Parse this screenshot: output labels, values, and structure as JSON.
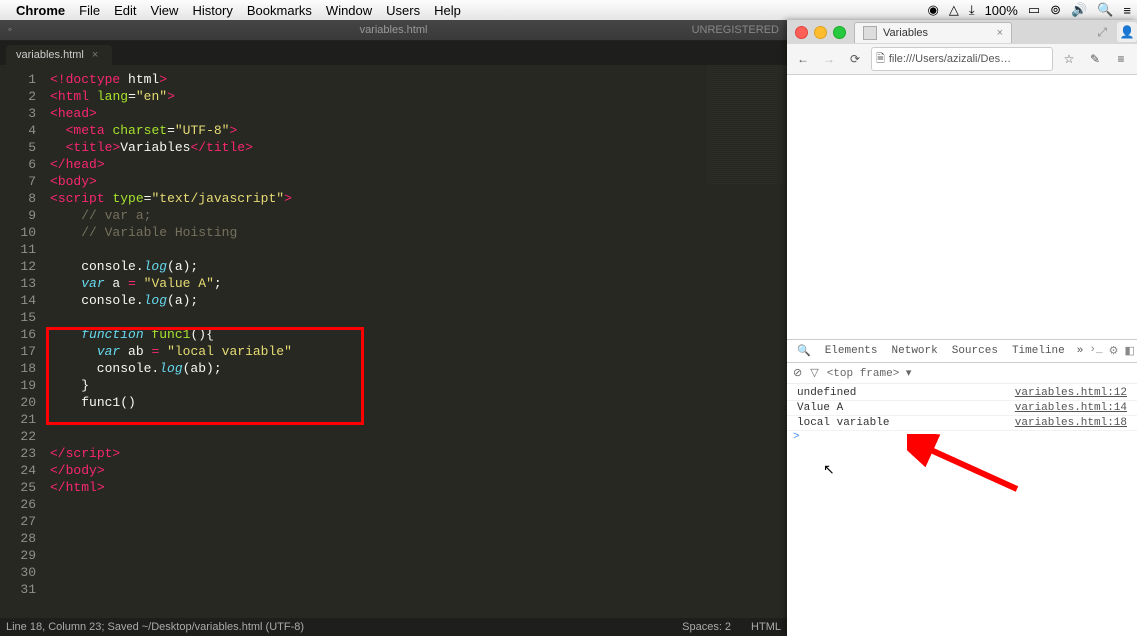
{
  "menubar": {
    "app": "Chrome",
    "items": [
      "File",
      "Edit",
      "View",
      "History",
      "Bookmarks",
      "Window",
      "Users",
      "Help"
    ],
    "battery": "100%"
  },
  "sublime": {
    "title": "variables.html",
    "unregistered": "UNREGISTERED",
    "tab": {
      "label": "variables.html"
    },
    "status_left": "Line 18, Column 23; Saved ~/Desktop/variables.html (UTF-8)",
    "status_spaces": "Spaces: 2",
    "status_lang": "HTML",
    "lines": [
      [
        {
          "t": "<!",
          "c": "c-tag"
        },
        {
          "t": "doctype",
          "c": "c-tag"
        },
        {
          "t": " html",
          "c": "c-name"
        },
        {
          "t": ">",
          "c": "c-tag"
        }
      ],
      [
        {
          "t": "<",
          "c": "c-tag"
        },
        {
          "t": "html",
          "c": "c-tag"
        },
        {
          "t": " ",
          "c": ""
        },
        {
          "t": "lang",
          "c": "c-attr"
        },
        {
          "t": "=",
          "c": "c-punct"
        },
        {
          "t": "\"en\"",
          "c": "c-str"
        },
        {
          "t": ">",
          "c": "c-tag"
        }
      ],
      [
        {
          "t": "<",
          "c": "c-tag"
        },
        {
          "t": "head",
          "c": "c-tag"
        },
        {
          "t": ">",
          "c": "c-tag"
        }
      ],
      [
        {
          "t": "  ",
          "c": ""
        },
        {
          "t": "<",
          "c": "c-tag"
        },
        {
          "t": "meta",
          "c": "c-tag"
        },
        {
          "t": " ",
          "c": ""
        },
        {
          "t": "charset",
          "c": "c-attr"
        },
        {
          "t": "=",
          "c": "c-punct"
        },
        {
          "t": "\"UTF-8\"",
          "c": "c-str"
        },
        {
          "t": ">",
          "c": "c-tag"
        }
      ],
      [
        {
          "t": "  ",
          "c": ""
        },
        {
          "t": "<",
          "c": "c-tag"
        },
        {
          "t": "title",
          "c": "c-tag"
        },
        {
          "t": ">",
          "c": "c-tag"
        },
        {
          "t": "Variables",
          "c": "c-name"
        },
        {
          "t": "</",
          "c": "c-tag"
        },
        {
          "t": "title",
          "c": "c-tag"
        },
        {
          "t": ">",
          "c": "c-tag"
        }
      ],
      [
        {
          "t": "</",
          "c": "c-tag"
        },
        {
          "t": "head",
          "c": "c-tag"
        },
        {
          "t": ">",
          "c": "c-tag"
        }
      ],
      [
        {
          "t": "<",
          "c": "c-tag"
        },
        {
          "t": "body",
          "c": "c-tag"
        },
        {
          "t": ">",
          "c": "c-tag"
        }
      ],
      [
        {
          "t": "<",
          "c": "c-tag"
        },
        {
          "t": "script",
          "c": "c-tag"
        },
        {
          "t": " ",
          "c": ""
        },
        {
          "t": "type",
          "c": "c-attr"
        },
        {
          "t": "=",
          "c": "c-punct"
        },
        {
          "t": "\"text/javascript\"",
          "c": "c-str"
        },
        {
          "t": ">",
          "c": "c-tag"
        }
      ],
      [
        {
          "t": "    ",
          "c": ""
        },
        {
          "t": "// var a;",
          "c": "c-com"
        }
      ],
      [
        {
          "t": "    ",
          "c": ""
        },
        {
          "t": "// Variable Hoisting",
          "c": "c-com"
        }
      ],
      [],
      [
        {
          "t": "    console.",
          "c": "c-name"
        },
        {
          "t": "log",
          "c": "c-kw"
        },
        {
          "t": "(a);",
          "c": "c-name"
        }
      ],
      [
        {
          "t": "    ",
          "c": ""
        },
        {
          "t": "var",
          "c": "c-var"
        },
        {
          "t": " a ",
          "c": "c-name"
        },
        {
          "t": "=",
          "c": "c-op"
        },
        {
          "t": " ",
          "c": ""
        },
        {
          "t": "\"Value A\"",
          "c": "c-str"
        },
        {
          "t": ";",
          "c": "c-name"
        }
      ],
      [
        {
          "t": "    console.",
          "c": "c-name"
        },
        {
          "t": "log",
          "c": "c-kw"
        },
        {
          "t": "(a);",
          "c": "c-name"
        }
      ],
      [],
      [
        {
          "t": "    ",
          "c": ""
        },
        {
          "t": "function",
          "c": "c-var"
        },
        {
          "t": " ",
          "c": ""
        },
        {
          "t": "func1",
          "c": "c-fn"
        },
        {
          "t": "(){",
          "c": "c-name"
        }
      ],
      [
        {
          "t": "      ",
          "c": ""
        },
        {
          "t": "var",
          "c": "c-var"
        },
        {
          "t": " ab ",
          "c": "c-name"
        },
        {
          "t": "=",
          "c": "c-op"
        },
        {
          "t": " ",
          "c": ""
        },
        {
          "t": "\"local variable\"",
          "c": "c-str"
        }
      ],
      [
        {
          "t": "      console.",
          "c": "c-name"
        },
        {
          "t": "log",
          "c": "c-kw"
        },
        {
          "t": "(ab);",
          "c": "c-name"
        }
      ],
      [
        {
          "t": "    }",
          "c": "c-name"
        }
      ],
      [
        {
          "t": "    ",
          "c": ""
        },
        {
          "t": "func1",
          "c": "c-name"
        },
        {
          "t": "()",
          "c": "c-name"
        }
      ],
      [],
      [],
      [
        {
          "t": "</",
          "c": "c-tag"
        },
        {
          "t": "script",
          "c": "c-tag"
        },
        {
          "t": ">",
          "c": "c-tag"
        }
      ],
      [
        {
          "t": "</",
          "c": "c-tag"
        },
        {
          "t": "body",
          "c": "c-tag"
        },
        {
          "t": ">",
          "c": "c-tag"
        }
      ],
      [
        {
          "t": "</",
          "c": "c-tag"
        },
        {
          "t": "html",
          "c": "c-tag"
        },
        {
          "t": ">",
          "c": "c-tag"
        }
      ],
      [],
      [],
      [],
      [],
      [],
      []
    ]
  },
  "chrome": {
    "tab_title": "Variables",
    "url": "file:///Users/azizali/Des…",
    "url_scheme": "file://",
    "devtools": {
      "tabs": [
        "Elements",
        "Network",
        "Sources",
        "Timeline"
      ],
      "frame": "<top frame> ▾",
      "rows": [
        {
          "msg": "undefined",
          "src": "variables.html:12"
        },
        {
          "msg": "Value A",
          "src": "variables.html:14"
        },
        {
          "msg": "local variable",
          "src": "variables.html:18"
        }
      ],
      "prompt": ">"
    }
  }
}
